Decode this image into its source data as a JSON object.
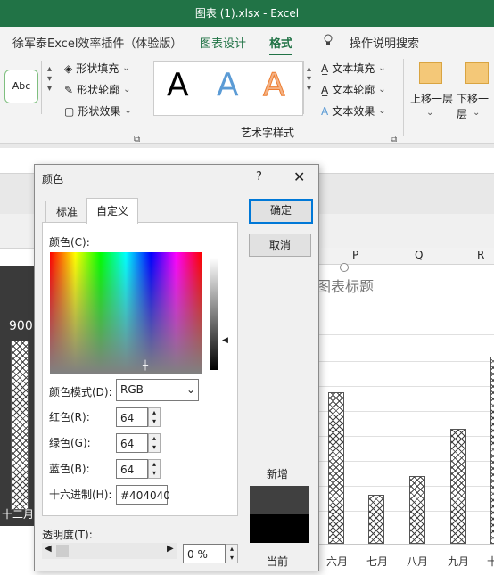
{
  "window": {
    "title": "图表 (1).xlsx  -  Excel"
  },
  "tabs": {
    "plugin": "徐军泰Excel效率插件（体验版）",
    "chart_design": "图表设计",
    "format": "格式",
    "search_label": "操作说明搜索"
  },
  "ribbon": {
    "style_preview": "Abc",
    "shape_fill": "形状填充",
    "shape_outline": "形状轮廓",
    "shape_effects": "形状效果",
    "wordart_letter": "A",
    "text_fill": "文本填充",
    "text_outline": "文本轮廓",
    "text_effects": "文本效果",
    "wordart_group": "艺术字样式",
    "bring_forward": "上移一层",
    "send_backward": "下移一层"
  },
  "sheet": {
    "columns": [
      "P",
      "Q",
      "R"
    ],
    "chart_title": "图表标题",
    "value_label": "900",
    "x_labels": [
      "十二月",
      "六月",
      "七月",
      "八月",
      "九月",
      "十"
    ]
  },
  "dialog": {
    "title": "颜色",
    "help": "?",
    "tab_standard": "标准",
    "tab_custom": "自定义",
    "colors_label": "颜色(C):",
    "model_label": "颜色模式(D):",
    "model_value": "RGB",
    "red_label": "红色(R):",
    "red_value": "64",
    "green_label": "绿色(G):",
    "green_value": "64",
    "blue_label": "蓝色(B):",
    "blue_value": "64",
    "hex_label": "十六进制(H):",
    "hex_value": "#404040",
    "transparency_label": "透明度(T):",
    "transparency_value": "0 %",
    "ok": "确定",
    "cancel": "取消",
    "new_label": "新增",
    "current_label": "当前",
    "new_color": "#404040",
    "current_color": "#000000"
  }
}
